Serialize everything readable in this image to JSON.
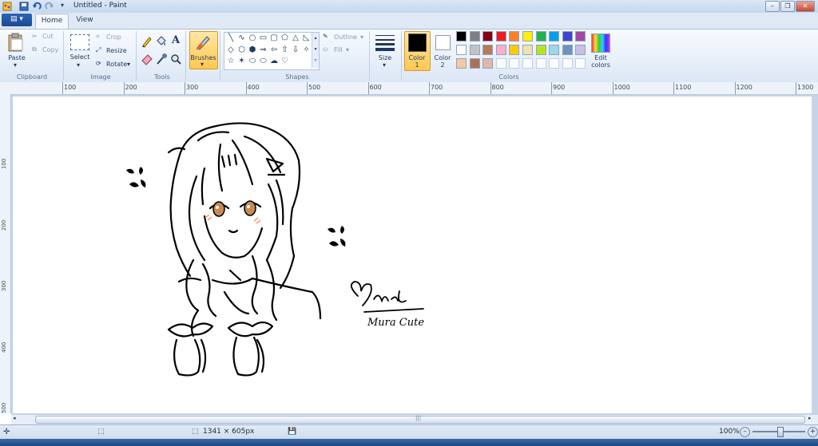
{
  "window": {
    "title": "Untitled - Paint"
  },
  "tabs": {
    "file": "▤ ▾",
    "home": "Home",
    "view": "View"
  },
  "clipboard": {
    "paste": "Paste",
    "cut": "Cut",
    "copy": "Copy",
    "group": "Clipboard"
  },
  "image": {
    "select": "Select",
    "crop": "Crop",
    "resize": "Resize",
    "rotate": "Rotate",
    "group": "Image"
  },
  "tools": {
    "group": "Tools",
    "text_icon": "A"
  },
  "brushes": {
    "label": "Brushes"
  },
  "shapes": {
    "outline": "Outline",
    "fill": "Fill",
    "group": "Shapes",
    "glyphs": [
      "╲",
      "∿",
      "○",
      "▭",
      "▢",
      "⬠",
      "△",
      "◺",
      "◇",
      "⬡",
      "⬢",
      "⇒",
      "⇦",
      "⇧",
      "⇩",
      "✧",
      "☆",
      "✶",
      "⬭",
      "⬭",
      "☁",
      "♡"
    ]
  },
  "size": {
    "label": "Size"
  },
  "colors": {
    "color1": "Color",
    "color1_num": "1",
    "color2": "Color",
    "color2_num": "2",
    "edit": "Edit",
    "edit2": "colors",
    "group": "Colors",
    "color1_value": "#000000",
    "color2_value": "#ffffff",
    "row1": [
      "#000000",
      "#7f7f7f",
      "#880015",
      "#ed1c24",
      "#ff7f27",
      "#fff200",
      "#22b14c",
      "#00a2e8",
      "#3f48cc",
      "#a349a4"
    ],
    "row2": [
      "#ffffff",
      "#c3c3c3",
      "#b97a57",
      "#ffaec9",
      "#ffc90e",
      "#efe4b0",
      "#b5e61d",
      "#99d9ea",
      "#7092be",
      "#c8bfe7"
    ],
    "row3": [
      "#f5c8a0",
      "#b07050",
      "#e0b8a8"
    ]
  },
  "ruler": {
    "h": [
      "100",
      "200",
      "300",
      "400",
      "500",
      "600",
      "700",
      "800",
      "900",
      "1000",
      "1100",
      "1200",
      "1300"
    ],
    "v": [
      "100",
      "200",
      "300",
      "400",
      "500"
    ]
  },
  "drawing": {
    "signature": "Mura Cute"
  },
  "status": {
    "dimensions": "1341 × 605px",
    "zoom": "100%"
  }
}
